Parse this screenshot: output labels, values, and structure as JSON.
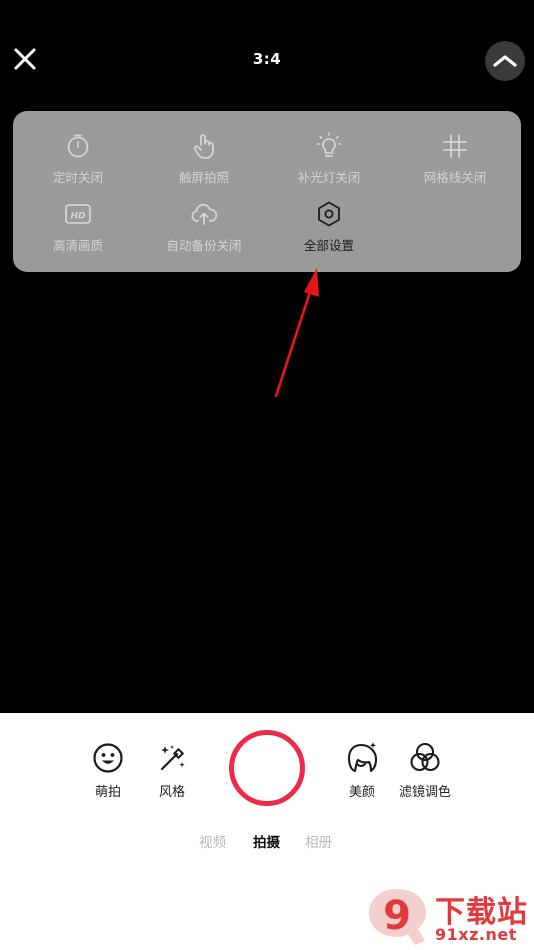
{
  "header": {
    "aspect_ratio": "3:4"
  },
  "settings_panel": {
    "items": [
      {
        "label": "定时关闭",
        "icon": "timer-icon"
      },
      {
        "label": "触屏拍照",
        "icon": "touch-icon"
      },
      {
        "label": "补光灯关闭",
        "icon": "bulb-icon"
      },
      {
        "label": "网格线关闭",
        "icon": "grid-icon"
      },
      {
        "label": "高清画质",
        "icon": "hd-icon"
      },
      {
        "label": "自动备份关闭",
        "icon": "cloud-upload-icon"
      },
      {
        "label": "全部设置",
        "icon": "settings-hexagon-icon"
      }
    ]
  },
  "toolbar": {
    "items": [
      {
        "label": "萌拍",
        "icon": "smiley-icon"
      },
      {
        "label": "风格",
        "icon": "magic-wand-icon"
      },
      {
        "label": "美颜",
        "icon": "beauty-face-icon"
      },
      {
        "label": "滤镜调色",
        "icon": "filter-circles-icon"
      }
    ]
  },
  "modes": [
    {
      "label": "视频",
      "active": false
    },
    {
      "label": "拍摄",
      "active": true
    },
    {
      "label": "相册",
      "active": false
    }
  ],
  "watermark": {
    "logo_text": "9",
    "title": "下载站",
    "url": "91xz.net"
  },
  "colors": {
    "accent": "#ee2a4a",
    "panel": "#9a9a9a",
    "annotation_arrow": "#e8141c",
    "watermark": "#e23a3a"
  }
}
